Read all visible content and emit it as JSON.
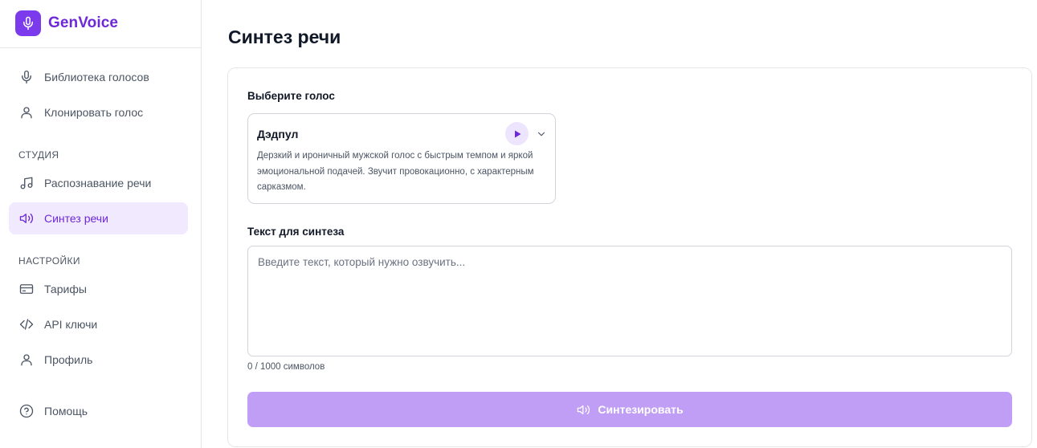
{
  "brand": {
    "name": "GenVoice",
    "icon": "microphone-icon",
    "color": "#6d28d9",
    "logo_bg": "#7c3aed"
  },
  "sidebar": {
    "items_top": [
      {
        "label": "Библиотека голосов",
        "icon": "microphone-icon"
      },
      {
        "label": "Клонировать голос",
        "icon": "user-icon"
      }
    ],
    "studio_title": "СТУДИЯ",
    "studio_items": [
      {
        "label": "Распознавание речи",
        "icon": "music-note-icon",
        "active": false
      },
      {
        "label": "Синтез речи",
        "icon": "speaker-icon",
        "active": true
      }
    ],
    "settings_title": "НАСТРОЙКИ",
    "settings_items": [
      {
        "label": "Тарифы",
        "icon": "credit-card-icon"
      },
      {
        "label": "API ключи",
        "icon": "code-icon"
      },
      {
        "label": "Профиль",
        "icon": "user-icon"
      }
    ],
    "help": {
      "label": "Помощь",
      "icon": "help-circle-icon"
    }
  },
  "main": {
    "title": "Синтез речи",
    "voice_label": "Выберите голос",
    "voice": {
      "name": "Дэдпул",
      "description": "Дерзкий и ироничный мужской голос с быстрым темпом и яркой эмоциональной подачей. Звучит провокационно, с характерным сарказмом."
    },
    "text_label": "Текст для синтеза",
    "text_value": "",
    "text_placeholder": "Введите текст, который нужно озвучить...",
    "counter": "0 / 1000 символов",
    "synth_button": "Синтезировать"
  },
  "colors": {
    "accent": "#7c3aed",
    "active_bg": "#f1e9fd",
    "button_disabled": "#c09ef5"
  }
}
